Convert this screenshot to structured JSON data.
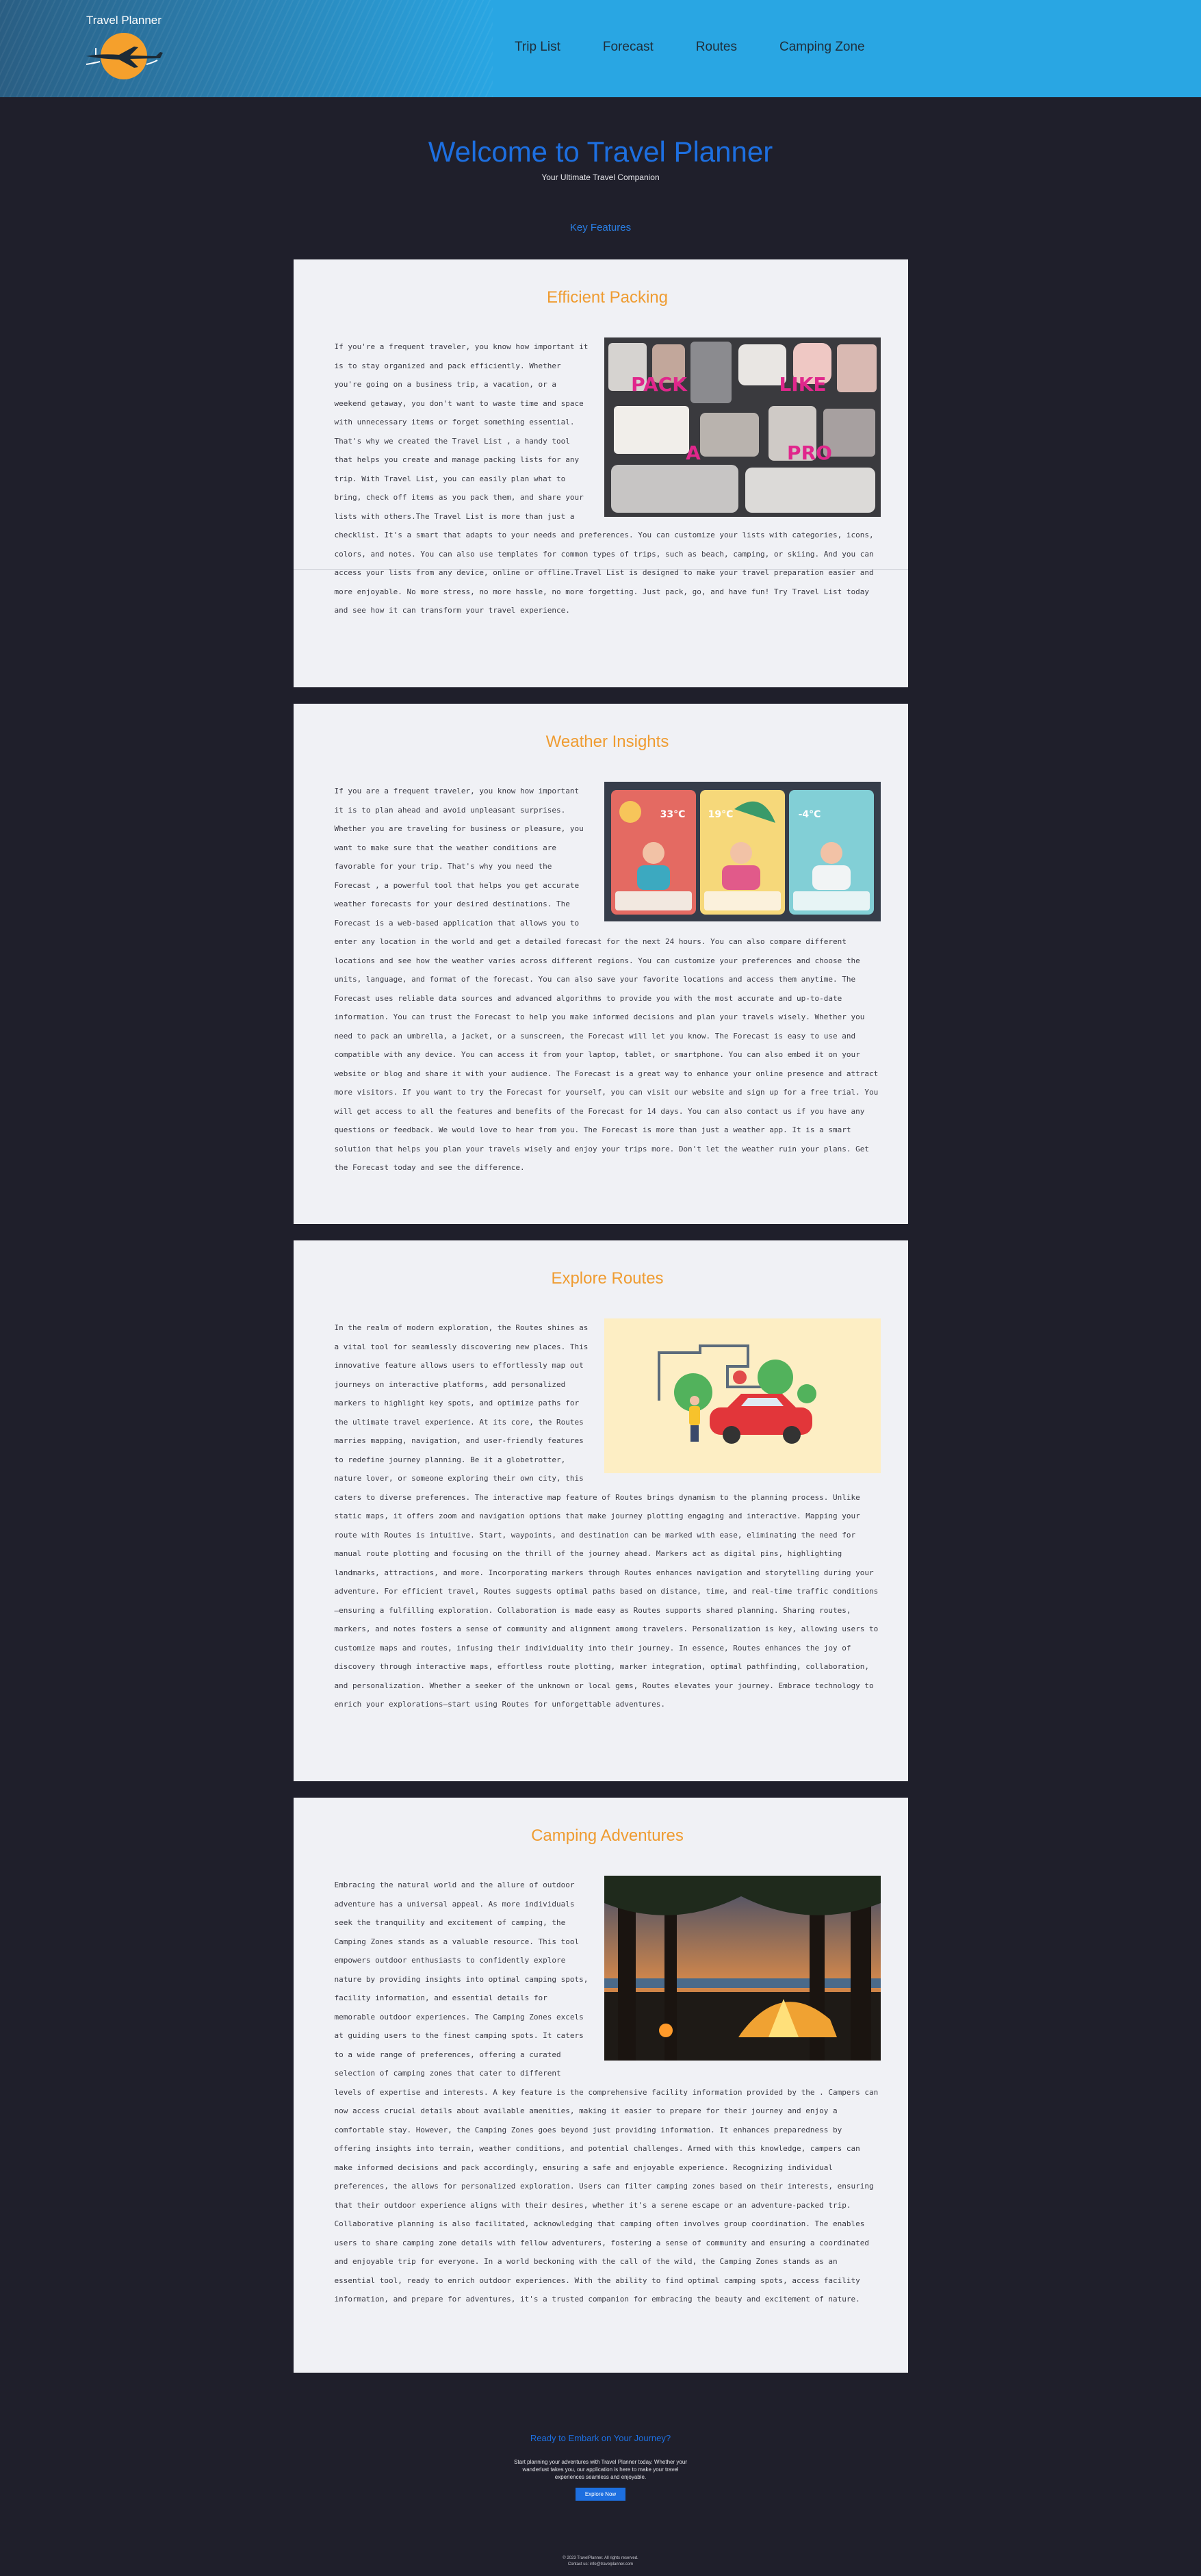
{
  "header": {
    "brand": "Travel Planner",
    "nav": [
      "Trip List",
      "Forecast",
      "Routes",
      "Camping Zone"
    ]
  },
  "hero": {
    "title": "Welcome to Travel Planner",
    "subtitle": "Your Ultimate Travel Companion"
  },
  "key_features": "Key Features",
  "cards": [
    {
      "title": "Efficient Packing",
      "image_text": [
        "PACK",
        "LIKE",
        "A",
        "PRO"
      ],
      "text": "If you're a frequent traveler, you know how important it is to stay organized and pack efficiently. Whether you're going on a business trip, a vacation, or a weekend getaway, you don't want to waste time and space with unnecessary items or forget something essential. That's why we created the Travel List , a handy tool that helps you create and manage packing lists for any trip. With Travel List, you can easily plan what to bring, check off items as you pack them, and share your lists with others.The Travel List is more than just a checklist. It's a smart that adapts to your needs and preferences. You can customize your lists with categories, icons, colors, and notes. You can also use templates for common types of trips, such as beach, camping, or skiing. And you can access your lists from any device, online or offline.Travel List is designed to make your travel preparation easier and more enjoyable. No more stress, no more hassle, no more forgetting. Just pack, go, and have fun! Try Travel List today and see how it can transform your travel experience."
    },
    {
      "title": "Weather Insights",
      "image_text": [
        "33°C",
        "19°C",
        "-4°C"
      ],
      "text": "If you are a frequent traveler, you know how important it is to plan ahead and avoid unpleasant surprises. Whether you are traveling for business or pleasure, you want to make sure that the weather conditions are favorable for your trip. That's why you need the Forecast , a powerful tool that helps you get accurate weather forecasts for your desired destinations. The Forecast is a web-based application that allows you to enter any location in the world and get a detailed forecast for the next 24 hours. You can also compare different locations and see how the weather varies across different regions. You can customize your preferences and choose the units, language, and format of the forecast. You can also save your favorite locations and access them anytime. The Forecast uses reliable data sources and advanced algorithms to provide you with the most accurate and up-to-date information. You can trust the Forecast to help you make informed decisions and plan your travels wisely. Whether you need to pack an umbrella, a jacket, or a sunscreen, the Forecast will let you know. The Forecast is easy to use and compatible with any device. You can access it from your laptop, tablet, or smartphone. You can also embed it on your website or blog and share it with your audience. The Forecast is a great way to enhance your online presence and attract more visitors. If you want to try the Forecast for yourself, you can visit our website and sign up for a free trial. You will get access to all the features and benefits of the Forecast for 14 days. You can also contact us if you have any questions or feedback. We would love to hear from you. The Forecast is more than just a weather app. It is a smart solution that helps you plan your travels wisely and enjoy your trips more. Don't let the weather ruin your plans. Get the Forecast today and see the difference."
    },
    {
      "title": "Explore Routes",
      "text": "In the realm of modern exploration, the Routes shines as a vital tool for seamlessly discovering new places. This innovative feature allows users to effortlessly map out journeys on interactive platforms, add personalized markers to highlight key spots, and optimize paths for the ultimate travel experience. At its core, the Routes marries mapping, navigation, and user-friendly features to redefine journey planning. Be it a globetrotter, nature lover, or someone exploring their own city, this caters to diverse preferences. The interactive map feature of Routes brings dynamism to the planning process. Unlike static maps, it offers zoom and navigation options that make journey plotting engaging and interactive. Mapping your route with Routes is intuitive. Start, waypoints, and destination can be marked with ease, eliminating the need for manual route plotting and focusing on the thrill of the journey ahead. Markers act as digital pins, highlighting landmarks, attractions, and more. Incorporating markers through Routes enhances navigation and storytelling during your adventure. For efficient travel, Routes suggests optimal paths based on distance, time, and real-time traffic conditions—ensuring a fulfilling exploration. Collaboration is made easy as Routes supports shared planning. Sharing routes, markers, and notes fosters a sense of community and alignment among travelers. Personalization is key, allowing users to customize maps and routes, infusing their individuality into their journey. In essence, Routes enhances the joy of discovery through interactive maps, effortless route plotting, marker integration, optimal pathfinding, collaboration, and personalization. Whether a seeker of the unknown or local gems, Routes elevates your journey. Embrace technology to enrich your explorations—start using Routes for unforgettable adventures."
    },
    {
      "title": "Camping Adventures",
      "text": "Embracing the natural world and the allure of outdoor adventure has a universal appeal. As more individuals seek the tranquility and excitement of camping, the Camping Zones stands as a valuable resource. This tool empowers outdoor enthusiasts to confidently explore nature by providing insights into optimal camping spots, facility information, and essential details for memorable outdoor experiences. The Camping Zones excels at guiding users to the finest camping spots. It caters to a wide range of preferences, offering a curated selection of camping zones that cater to different levels of expertise and interests. A key feature is the comprehensive facility information provided by the . Campers can now access crucial details about available amenities, making it easier to prepare for their journey and enjoy a comfortable stay. However, the Camping Zones goes beyond just providing information. It enhances preparedness by offering insights into terrain, weather conditions, and potential challenges. Armed with this knowledge, campers can make informed decisions and pack accordingly, ensuring a safe and enjoyable experience. Recognizing individual preferences, the allows for personalized exploration. Users can filter camping zones based on their interests, ensuring that their outdoor experience aligns with their desires, whether it's a serene escape or an adventure-packed trip. Collaborative planning is also facilitated, acknowledging that camping often involves group coordination. The enables users to share camping zone details with fellow adventurers, fostering a sense of community and ensuring a coordinated and enjoyable trip for everyone. In a world beckoning with the call of the wild, the Camping Zones stands as an essential tool, ready to enrich outdoor experiences. With the ability to find optimal camping spots, access facility information, and prepare for adventures, it's a trusted companion for embracing the beauty and excitement of nature."
    }
  ],
  "cta": {
    "title": "Ready to Embark on Your Journey?",
    "text": "Start planning your adventures with Travel Planner today. Whether your wanderlust takes you, our application is here to make your travel experiences seamless and enjoyable.",
    "button": "Explore Now"
  },
  "footer": {
    "copyright": "© 2023 TravelPlanner. All rights reserved.",
    "contact": "Contact us: info@travelplanner.com"
  },
  "colors": {
    "header_bg": "#29a6e3",
    "page_bg": "#1f1f2b",
    "card_bg": "#f0f1f5",
    "title_blue": "#1d6fe0",
    "card_title_orange": "#ef9c31"
  }
}
